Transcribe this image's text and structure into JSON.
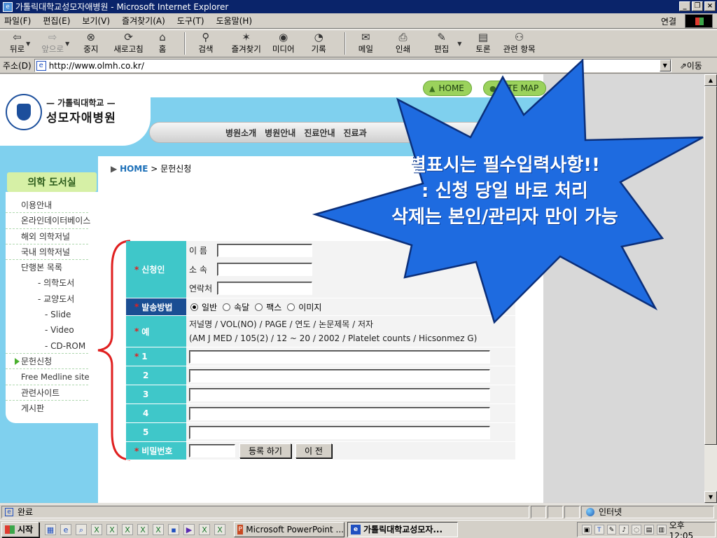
{
  "window": {
    "title": "가톨릭대학교성모자애병원 - Microsoft Internet Explorer",
    "minimize": "_",
    "maximize": "❐",
    "close": "×"
  },
  "menu": {
    "items": [
      "파일(F)",
      "편집(E)",
      "보기(V)",
      "즐겨찾기(A)",
      "도구(T)",
      "도움말(H)"
    ],
    "links_label": "연결"
  },
  "toolbar": {
    "back": "뒤로",
    "forward": "앞으로",
    "stop": "중지",
    "refresh": "새로고침",
    "home": "홈",
    "search": "검색",
    "favorites": "즐겨찾기",
    "media": "미디어",
    "history": "기록",
    "mail": "메일",
    "print": "인쇄",
    "edit": "편집",
    "discuss": "토론",
    "related": "관련 항목"
  },
  "address": {
    "label": "주소(D)",
    "url": "http://www.olmh.co.kr/",
    "go": "이동"
  },
  "site": {
    "logo_sub": "— 가톨릭대학교 —",
    "logo_main": "성모자애병원",
    "home_pill": "HOME",
    "sitemap_pill": "SITE MAP",
    "nav": [
      "병원소개",
      "병원안내",
      "진료안내",
      "진료과"
    ]
  },
  "sidebar": {
    "heading": "의학 도서실",
    "items": [
      {
        "label": "이용안내",
        "sub": false,
        "active": false
      },
      {
        "label": "온라인데이터베이스",
        "sub": false,
        "active": false
      },
      {
        "label": "해외 의학저널",
        "sub": false,
        "active": false
      },
      {
        "label": "국내 의학저널",
        "sub": false,
        "active": false
      },
      {
        "label": "단행본 목록",
        "sub": false,
        "active": false
      },
      {
        "label": "- 의학도서",
        "sub": true,
        "active": false
      },
      {
        "label": "- 교양도서",
        "sub": true,
        "active": false
      },
      {
        "label": "- Slide",
        "sub": true,
        "active": false
      },
      {
        "label": "- Video",
        "sub": true,
        "active": false
      },
      {
        "label": "- CD-ROM",
        "sub": true,
        "active": false
      },
      {
        "label": "문헌신청",
        "sub": false,
        "active": true
      },
      {
        "label": "Free Medline site",
        "sub": false,
        "active": false
      },
      {
        "label": "관련사이트",
        "sub": false,
        "active": false
      },
      {
        "label": "게시판",
        "sub": false,
        "active": false
      }
    ]
  },
  "breadcrumb": {
    "home": "HOME",
    "sep": ">",
    "current": "문헌신청"
  },
  "form": {
    "applicant_label": "신청인",
    "name_label": "이 름",
    "dept_label": "소 속",
    "contact_label": "연락처",
    "delivery_label": "발송방법",
    "delivery_options": [
      "일반",
      "속달",
      "팩스",
      "이미지"
    ],
    "delivery_selected": "일반",
    "example_label": "예",
    "example_line1": "저널명 / VOL(NO) / PAGE / 연도 / 논문제목 / 저자",
    "example_line2": "(AM J MED / 105(2) / 12 ~ 20 / 2002 / Platelet counts / Hicsonmez G)",
    "rows": [
      "1",
      "2",
      "3",
      "4",
      "5"
    ],
    "password_label": "비밀번호",
    "submit": "등록 하기",
    "back": "이 전",
    "required_mark": "*"
  },
  "callout": {
    "line1": "별표시는 필수입력사항!!",
    "line2": ": 신청 당일 바로 처리",
    "line3": "삭제는 본인/관리자 만이 가능"
  },
  "status": {
    "text": "완료",
    "zone": "인터넷"
  },
  "taskbar": {
    "start": "시작",
    "tasks": [
      "Microsoft PowerPoint ...",
      "가톨릭대학교성모자..."
    ],
    "clock": "오후 12:05"
  },
  "colors": {
    "title_bar": "#0a246a",
    "site_blue": "#7fd0ee",
    "form_label": "#3fc7c9",
    "callout": "#1e6be0",
    "bracket": "#e02020"
  }
}
